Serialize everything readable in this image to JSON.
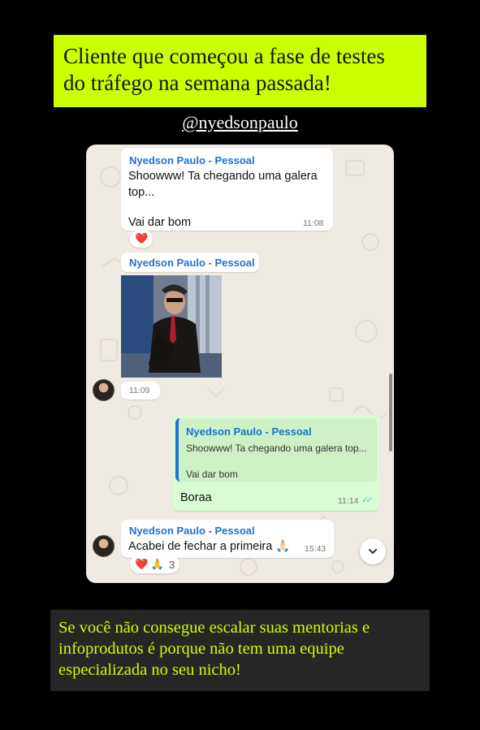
{
  "headline": {
    "lines": [
      "Cliente que começou a fase de testes",
      "do tráfego na semana passada!"
    ]
  },
  "handle": "@nyedsonpaulo",
  "chat": {
    "msg1": {
      "sender": "Nyedson Paulo - Pessoal",
      "line1": "Shoowww! Ta chegando uma galera",
      "line2": "top...",
      "line3": "Vai dar bom",
      "time": "11:08",
      "reaction": "❤️"
    },
    "msg2": {
      "sender": "Nyedson Paulo - Pessoal",
      "time": "11:09"
    },
    "msg3": {
      "quote_sender": "Nyedson Paulo - Pessoal",
      "quote_line1": "Shoowww! Ta chegando uma galera top...",
      "quote_line2": "Vai dar bom",
      "text": "Boraa",
      "time": "11:14",
      "ticks": "✓✓"
    },
    "msg4": {
      "sender": "Nyedson Paulo - Pessoal",
      "text": "Acabei de fechar a primeira 🙏🏻",
      "time": "15:43",
      "reaction_emoji": "❤️ 🙏",
      "reaction_count": "3"
    }
  },
  "footer": {
    "lines": [
      "Se você não consegue escalar suas mentorias e",
      "infoprodutos é porque não tem uma equipe",
      "especializada no seu nicho!"
    ]
  },
  "colors": {
    "headline_bg": "#ccff00",
    "chat_bg": "#efeae2",
    "sender": "#1b72d0",
    "outgoing_bubble": "#d9fdd3",
    "footer_text": "#ccff00"
  }
}
